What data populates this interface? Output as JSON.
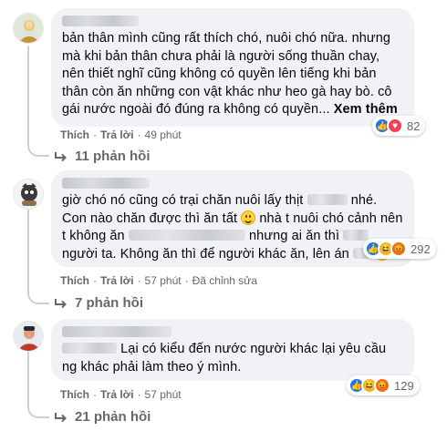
{
  "comments": [
    {
      "text": "bản thân mình cũng rất thích chó, nuôi chó nữa. nhưng mà khi bản thân chưa phải là người sống thuần chay, nên thiết nghĩ cũng không có quyền lên tiếng khi bản thân còn ăn những con vật khác như heo gà hay bò. cô gái nước ngoài đó đúng ra không có quyền...",
      "see_more": "Xem thêm",
      "reaction_count": "82",
      "like": "Thích",
      "reply": "Trả lời",
      "time": "49 phút",
      "replies": "11 phản hồi"
    },
    {
      "text_a": "giờ chó nó cũng có trại chăn nuôi lấy thịt",
      "text_b": "nhé. Con nào chăn được thì ăn tất",
      "text_c": "nhà t nuôi chó cảnh nên t không ăn",
      "text_d": "nhưng ai ăn thì",
      "text_e": "người ta. Không ăn thì để người khác ăn, lên án",
      "reaction_count": "292",
      "like": "Thích",
      "reply": "Trả lời",
      "time": "57 phút",
      "edited": "Đã chỉnh sửa",
      "replies": "7 phản hồi"
    },
    {
      "text_a": "Lại có kiểu đến nước người khác lại yêu cầu ng",
      "text_b": "khác phải làm theo ý mình.",
      "reaction_count": "129",
      "like": "Thích",
      "reply": "Trả lời",
      "time": "57 phút",
      "replies": "21 phản hồi"
    }
  ],
  "separator": "·",
  "colors": {
    "bubble": "#f0f2f5",
    "meta": "#65676b",
    "like": "#1877f2",
    "love": "#f33e58"
  },
  "icons": [
    "avatar",
    "like-reaction-icon",
    "love-reaction-icon",
    "haha-reaction-icon",
    "angry-reaction-icon",
    "reply-arrow-icon",
    "smile-emoji-icon"
  ]
}
